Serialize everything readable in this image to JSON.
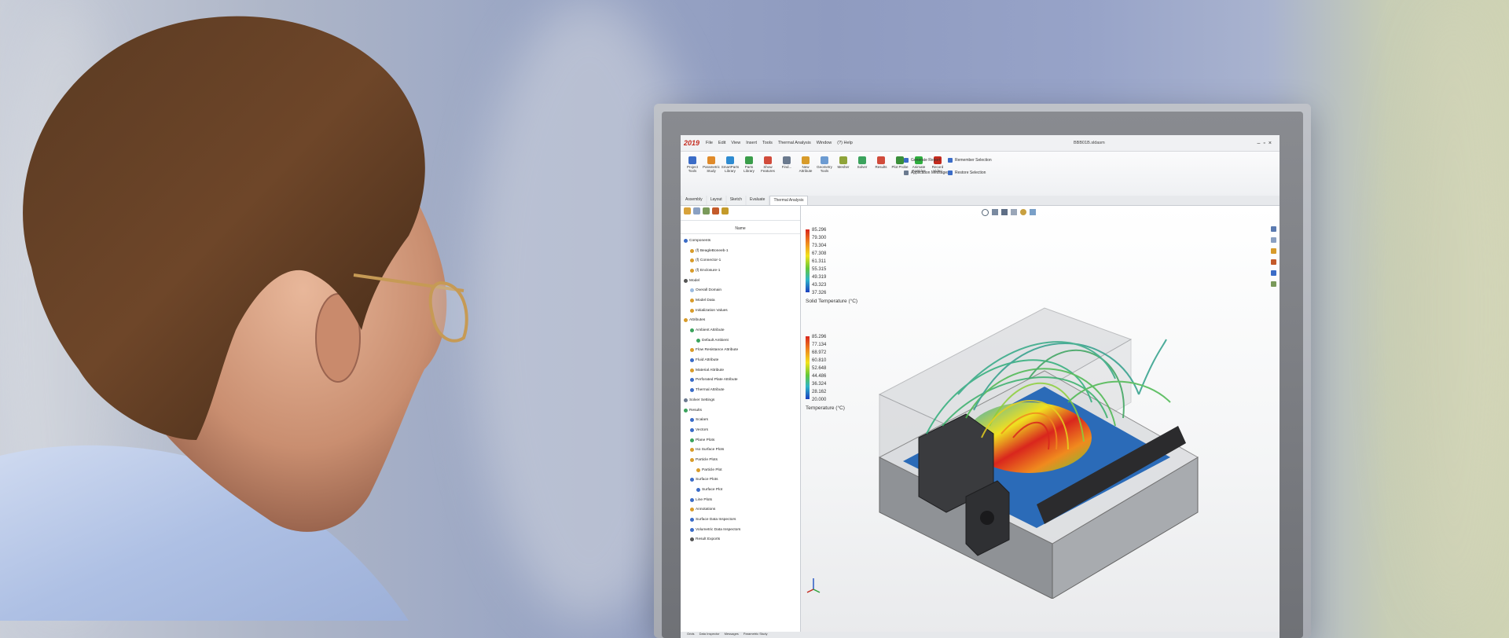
{
  "app": {
    "logo": "2019",
    "menus": [
      "File",
      "Edit",
      "View",
      "Insert",
      "Tools",
      "Thermal Analysis",
      "Window",
      "(?) Help"
    ],
    "file_title": "BBB01B.sldasm"
  },
  "ribbon": {
    "buttons": [
      {
        "label": "Project Tools",
        "color": "#3b6cc7"
      },
      {
        "label": "Parametric Study",
        "color": "#e08a2a"
      },
      {
        "label": "SmartParts Library",
        "color": "#2e8bd1"
      },
      {
        "label": "Parts Library",
        "color": "#3a9d4a"
      },
      {
        "label": "Show Features",
        "color": "#d14b3b"
      },
      {
        "label": "Find...",
        "color": "#6b7a8f"
      },
      {
        "label": "New Attribute",
        "color": "#d89b2a"
      },
      {
        "label": "Geometry Tools",
        "color": "#6c9bd2"
      },
      {
        "label": "Mesher",
        "color": "#8fa43a"
      },
      {
        "label": "Solver",
        "color": "#3ba35d"
      },
      {
        "label": "Results",
        "color": "#d14b3b"
      },
      {
        "label": "Plot Probe",
        "color": "#3a8f3a"
      },
      {
        "label": "Animate Particles",
        "color": "#2fae3f"
      },
      {
        "label": "Record Video",
        "color": "#c42a1e"
      }
    ],
    "group1": [
      "Generate Report",
      "Application Messages"
    ],
    "group2": [
      "Remember Selection",
      "Restore Selection"
    ]
  },
  "tabs": [
    "Assembly",
    "Layout",
    "Sketch",
    "Evaluate",
    "Thermal Analysis"
  ],
  "active_tab": "Thermal Analysis",
  "panel": {
    "column_header": "Name",
    "tree": [
      {
        "label": "Components",
        "color": "#3b6cc7",
        "indent": 0
      },
      {
        "label": "(f) BeagleBoneeb-1",
        "color": "#d89b2a",
        "indent": 1
      },
      {
        "label": "(f) Connector-1",
        "color": "#d89b2a",
        "indent": 1
      },
      {
        "label": "(f) Enclosure-1",
        "color": "#d89b2a",
        "indent": 1
      },
      {
        "label": "Model",
        "color": "#555555",
        "indent": 0
      },
      {
        "label": "Overall Domain",
        "color": "#9bbbe0",
        "indent": 1
      },
      {
        "label": "Model Data",
        "color": "#d89b2a",
        "indent": 1
      },
      {
        "label": "Initialization Values",
        "color": "#d89b2a",
        "indent": 1
      },
      {
        "label": "Attributes",
        "color": "#d89b2a",
        "indent": 0
      },
      {
        "label": "Ambient Attribute",
        "color": "#3ba35d",
        "indent": 1
      },
      {
        "label": "Default Ambient",
        "color": "#3ba35d",
        "indent": 2
      },
      {
        "label": "Flow Resistance Attribute",
        "color": "#d89b2a",
        "indent": 1
      },
      {
        "label": "Fluid Attribute",
        "color": "#3b6cc7",
        "indent": 1
      },
      {
        "label": "Material Attribute",
        "color": "#d89b2a",
        "indent": 1
      },
      {
        "label": "Perforated Plate Attribute",
        "color": "#3b6cc7",
        "indent": 1
      },
      {
        "label": "Thermal Attribute",
        "color": "#3b6cc7",
        "indent": 1
      },
      {
        "label": "Solver Settings",
        "color": "#6b7a8f",
        "indent": 0
      },
      {
        "label": "Results",
        "color": "#3ba35d",
        "indent": 0
      },
      {
        "label": "Scalars",
        "color": "#3b6cc7",
        "indent": 1
      },
      {
        "label": "Vectors",
        "color": "#3b6cc7",
        "indent": 1
      },
      {
        "label": "Plane Plots",
        "color": "#3ba35d",
        "indent": 1
      },
      {
        "label": "Iso Surface Plots",
        "color": "#d89b2a",
        "indent": 1
      },
      {
        "label": "Particle Plots",
        "color": "#d89b2a",
        "indent": 1
      },
      {
        "label": "Particle Plot",
        "color": "#d89b2a",
        "indent": 2
      },
      {
        "label": "Surface Plots",
        "color": "#3b6cc7",
        "indent": 1
      },
      {
        "label": "Surface Plot",
        "color": "#3b6cc7",
        "indent": 2
      },
      {
        "label": "Line Plots",
        "color": "#3b6cc7",
        "indent": 1
      },
      {
        "label": "Annotations",
        "color": "#d89b2a",
        "indent": 1
      },
      {
        "label": "Surface Data Inspectors",
        "color": "#3b6cc7",
        "indent": 1
      },
      {
        "label": "Volumetric Data Inspectors",
        "color": "#3b6cc7",
        "indent": 1
      },
      {
        "label": "Result Exports",
        "color": "#555555",
        "indent": 1
      }
    ]
  },
  "legends": [
    {
      "title": "Solid Temperature (°C)",
      "values": [
        "85.296",
        "79.300",
        "73.304",
        "67.308",
        "61.311",
        "55.315",
        "49.319",
        "43.323",
        "37.326"
      ]
    },
    {
      "title": "Temperature (°C)",
      "values": [
        "85.296",
        "77.134",
        "68.972",
        "60.810",
        "52.648",
        "44.486",
        "36.324",
        "28.162",
        "20.000"
      ]
    }
  ],
  "bottom_tabs": [
    "Grids",
    "Data Inspector",
    "Messages",
    "Parametric Study"
  ]
}
